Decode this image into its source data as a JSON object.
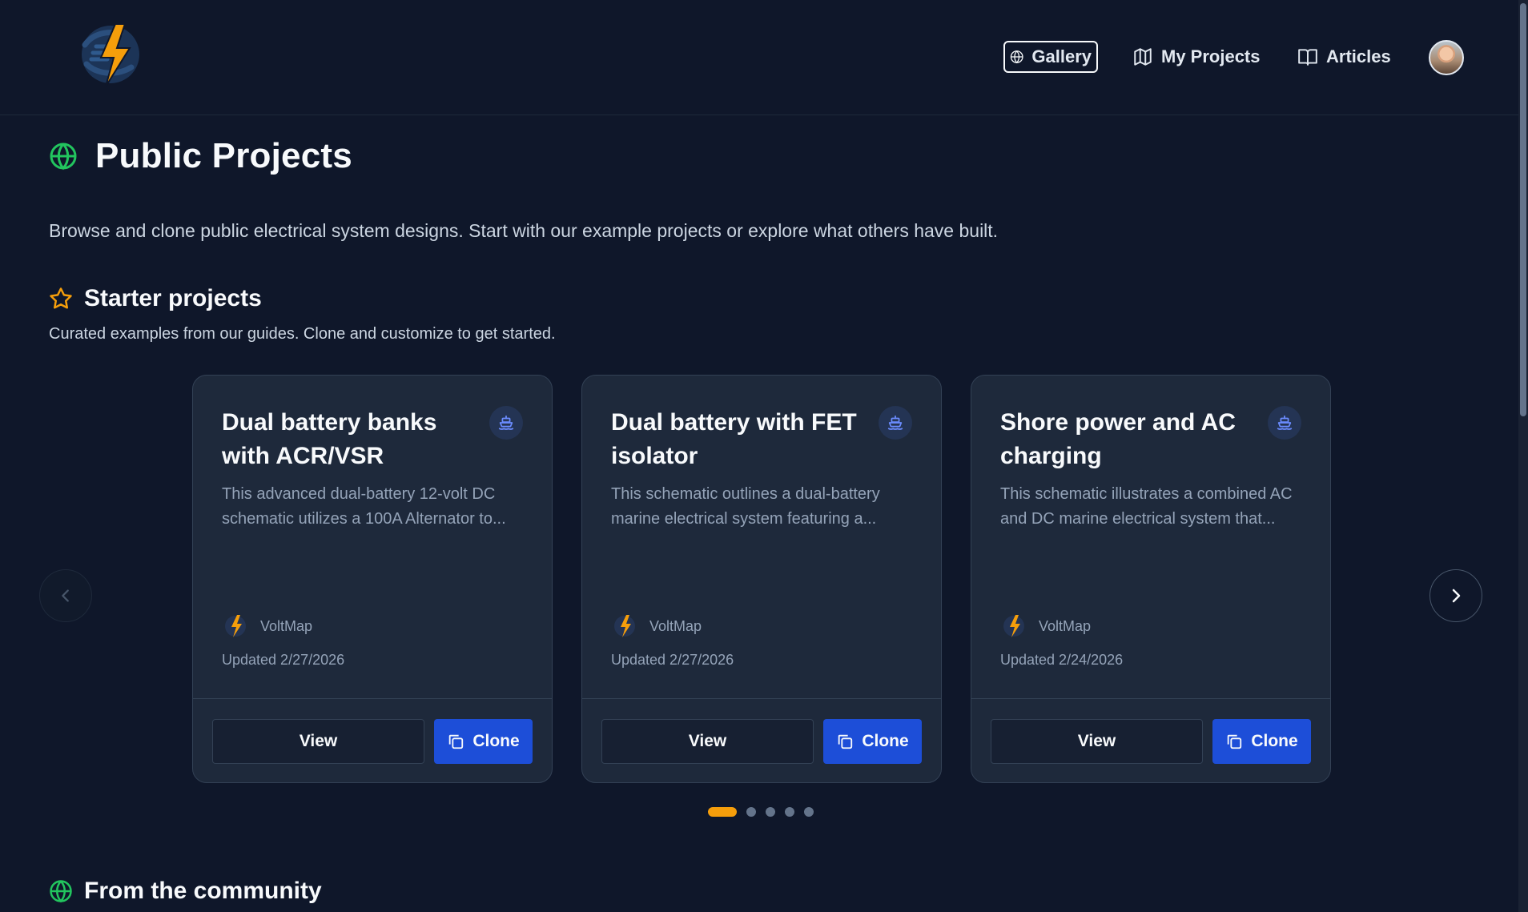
{
  "header": {
    "nav": [
      {
        "label": "Gallery",
        "icon": "globe-icon",
        "active": true
      },
      {
        "label": "My Projects",
        "icon": "map-icon"
      },
      {
        "label": "Articles",
        "icon": "book-icon"
      }
    ]
  },
  "page": {
    "title": "Public Projects",
    "subtitle": "Browse and clone public electrical system designs. Start with our example projects or explore what others have built."
  },
  "starter": {
    "title": "Starter projects",
    "description": "Curated examples from our guides. Clone and customize to get started.",
    "cards": [
      {
        "title": "Dual battery banks with ACR/VSR",
        "description": "This advanced dual-battery 12-volt DC schematic utilizes a 100A Alternator to...",
        "author": "VoltMap",
        "updated": "Updated 2/27/2026",
        "view_label": "View",
        "clone_label": "Clone"
      },
      {
        "title": "Dual battery with FET isolator",
        "description": "This schematic outlines a dual-battery marine electrical system featuring a...",
        "author": "VoltMap",
        "updated": "Updated 2/27/2026",
        "view_label": "View",
        "clone_label": "Clone"
      },
      {
        "title": "Shore power and AC charging",
        "description": "This schematic illustrates a combined AC and DC marine electrical system that...",
        "author": "VoltMap",
        "updated": "Updated 2/24/2026",
        "view_label": "View",
        "clone_label": "Clone"
      }
    ],
    "pagination": {
      "total": 5,
      "active": 1
    }
  },
  "community": {
    "title": "From the community"
  },
  "colors": {
    "background": "#0f172a",
    "card": "#1e293b",
    "accent_green": "#22c55e",
    "accent_orange": "#f59e0b",
    "button_blue": "#1d4ed8"
  }
}
